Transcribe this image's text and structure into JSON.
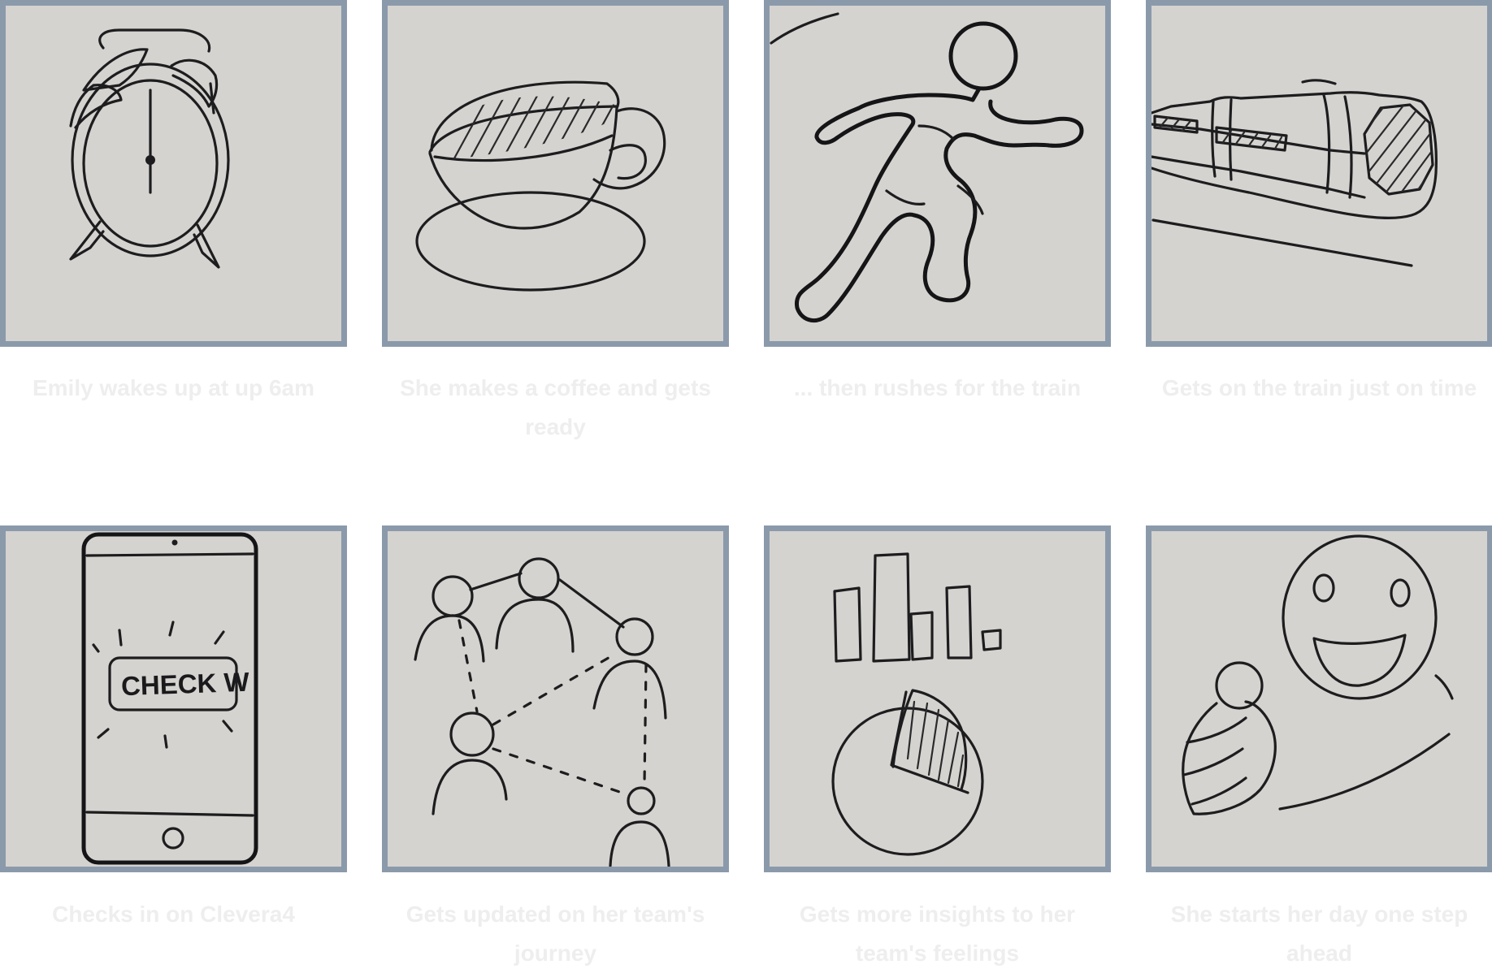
{
  "panels": [
    {
      "caption": "Emily wakes up at up 6am",
      "icon": "alarm-clock-icon"
    },
    {
      "caption": "She makes a coffee and gets ready",
      "icon": "coffee-cup-icon"
    },
    {
      "caption": "... then rushes for the train",
      "icon": "running-person-icon"
    },
    {
      "caption": "Gets on the train just on time",
      "icon": "train-icon"
    },
    {
      "caption": "Checks in on Clevera4",
      "icon": "smartphone-icon",
      "screen_text": "CHECK W"
    },
    {
      "caption": "Gets updated on her team's journey",
      "icon": "team-network-icon"
    },
    {
      "caption": "Gets more insights to her team's feelings",
      "icon": "charts-icon"
    },
    {
      "caption": "She starts her day one step ahead",
      "icon": "smiley-thumbs-up-icon"
    }
  ],
  "colors": {
    "frame": "#8b9aab",
    "paper": "#d5d3cf",
    "ink": "#1d1d1f",
    "caption": "#eeeeef"
  }
}
